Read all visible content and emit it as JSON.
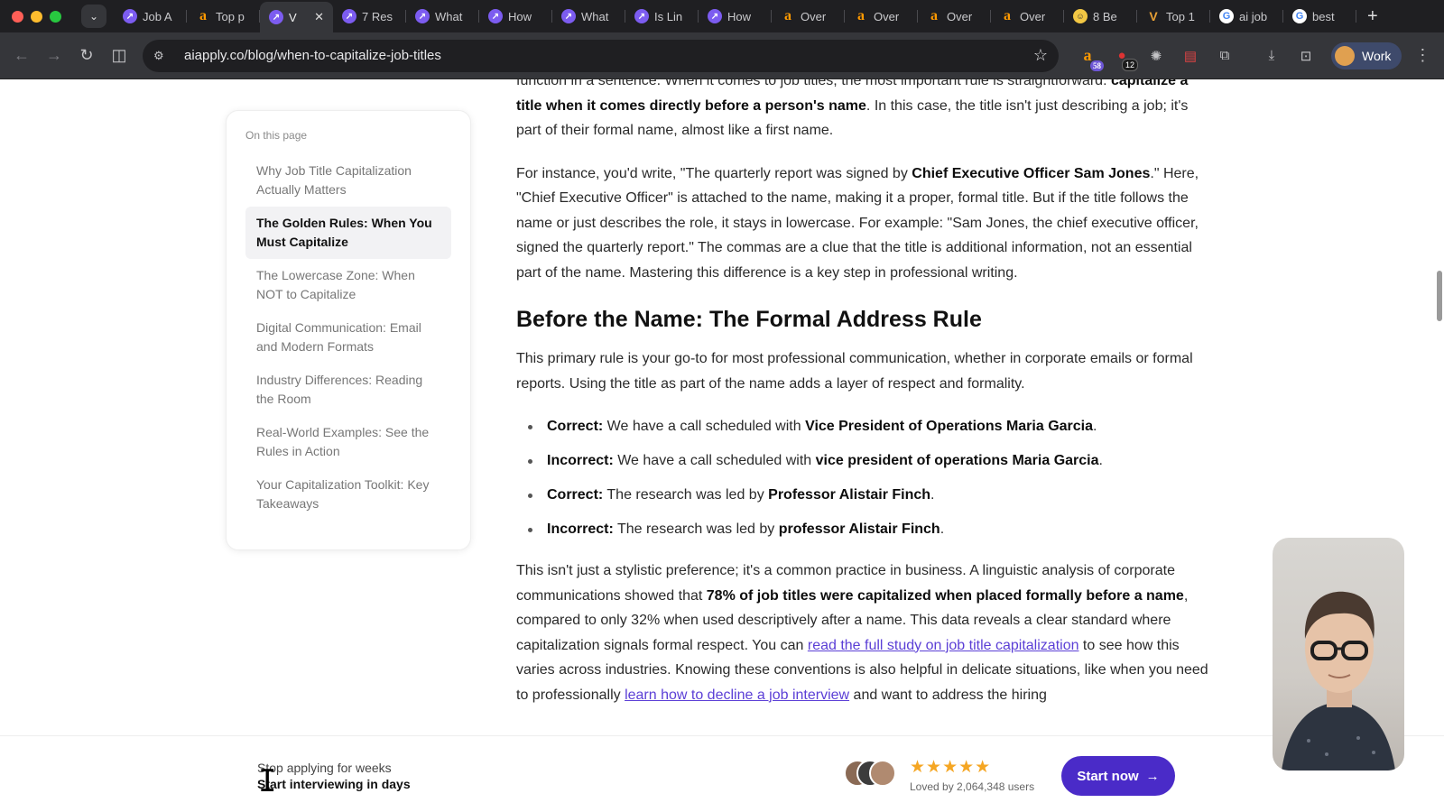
{
  "browser": {
    "tabs": [
      {
        "label": "Job A",
        "favicon": "aiapply-icon",
        "active": false
      },
      {
        "label": "Top p",
        "favicon": "amazon-icon",
        "active": false
      },
      {
        "label": "V",
        "favicon": "aiapply-icon",
        "active": true
      },
      {
        "label": "7 Res",
        "favicon": "aiapply-icon",
        "active": false
      },
      {
        "label": "What",
        "favicon": "aiapply-icon",
        "active": false
      },
      {
        "label": "How",
        "favicon": "aiapply-icon",
        "active": false
      },
      {
        "label": "What",
        "favicon": "aiapply-icon",
        "active": false
      },
      {
        "label": "Is Lin",
        "favicon": "aiapply-icon",
        "active": false
      },
      {
        "label": "How",
        "favicon": "aiapply-icon",
        "active": false
      },
      {
        "label": "Over",
        "favicon": "amazon-icon",
        "active": false
      },
      {
        "label": "Over",
        "favicon": "amazon-icon",
        "active": false
      },
      {
        "label": "Over",
        "favicon": "amazon-icon",
        "active": false
      },
      {
        "label": "Over",
        "favicon": "amazon-icon",
        "active": false
      },
      {
        "label": "8 Be",
        "favicon": "face-icon",
        "active": false
      },
      {
        "label": "Top 1",
        "favicon": "v-icon",
        "active": false
      },
      {
        "label": "ai job",
        "favicon": "google-icon",
        "active": false
      },
      {
        "label": "best",
        "favicon": "google-icon",
        "active": false
      }
    ],
    "url": "aiapply.co/blog/when-to-capitalize-job-titles",
    "extensions": {
      "badge1": "58",
      "badge2": "12"
    },
    "profile_label": "Work"
  },
  "toc": {
    "title": "On this page",
    "items": [
      {
        "label": "Why Job Title Capitalization Actually Matters"
      },
      {
        "label": "The Golden Rules: When You Must Capitalize"
      },
      {
        "label": "The Lowercase Zone: When NOT to Capitalize"
      },
      {
        "label": "Digital Communication: Email and Modern Formats"
      },
      {
        "label": "Industry Differences: Reading the Room"
      },
      {
        "label": "Real-World Examples: See the Rules in Action"
      },
      {
        "label": "Your Capitalization Toolkit: Key Takeaways"
      }
    ]
  },
  "article": {
    "p0_top": "function in a sentence. When it comes to job titles, the most important rule is straightforward:",
    "p0_bold": "capitalize a title when it comes directly before a person's name",
    "p0_rest": ". In this case, the title isn't just describing a job; it's part of their formal name, almost like a first name.",
    "p1_a": "For instance, you'd write, \"The quarterly report was signed by ",
    "p1_bold": "Chief Executive Officer Sam Jones",
    "p1_b": ".\" Here, \"Chief Executive Officer\" is attached to the name, making it a proper, formal title. But if the title follows the name or just describes the role, it stays in lowercase. For example: \"Sam Jones, the chief executive officer, signed the quarterly report.\" The commas are a clue that the title is additional information, not an essential part of the name. Mastering this difference is a key step in professional writing.",
    "heading": "Before the Name: The Formal Address Rule",
    "p2": "This primary rule is your go-to for most professional communication, whether in corporate emails or formal reports. Using the title as part of the name adds a layer of respect and formality.",
    "bullets": [
      {
        "label": "Correct:",
        "text": " We have a call scheduled with ",
        "bold": "Vice President of Operations Maria Garcia",
        "end": "."
      },
      {
        "label": "Incorrect:",
        "text": " We have a call scheduled with ",
        "bold": "vice president of operations Maria Garcia",
        "end": "."
      },
      {
        "label": "Correct:",
        "text": " The research was led by ",
        "bold": "Professor Alistair Finch",
        "end": "."
      },
      {
        "label": "Incorrect:",
        "text": " The research was led by ",
        "bold": "professor Alistair Finch",
        "end": "."
      }
    ],
    "p3_a": "This isn't just a stylistic preference; it's a common practice in business. A linguistic analysis of corporate communications showed that ",
    "p3_bold": "78% of job titles were capitalized when placed formally before a name",
    "p3_b": ", compared to only 32% when used descriptively after a name. This data reveals a clear standard where capitalization signals formal respect. You can ",
    "p3_link": "read the full study on job title capitalization",
    "p3_c": " to see how this varies across industries. Knowing these conventions is also helpful in delicate situations, like when you need to professionally ",
    "p3_link2": "learn how to decline a job interview",
    "p3_d": " and want to address the hiring"
  },
  "cta": {
    "line1": "Stop applying for weeks",
    "line2": "Start interviewing in days",
    "stars": "★★★★★",
    "loved": "Loved by 2,064,348 users",
    "button": "Start now"
  },
  "colors": {
    "accent": "#4a2bc8",
    "link": "#5b3fd6",
    "star": "#f5a623"
  }
}
